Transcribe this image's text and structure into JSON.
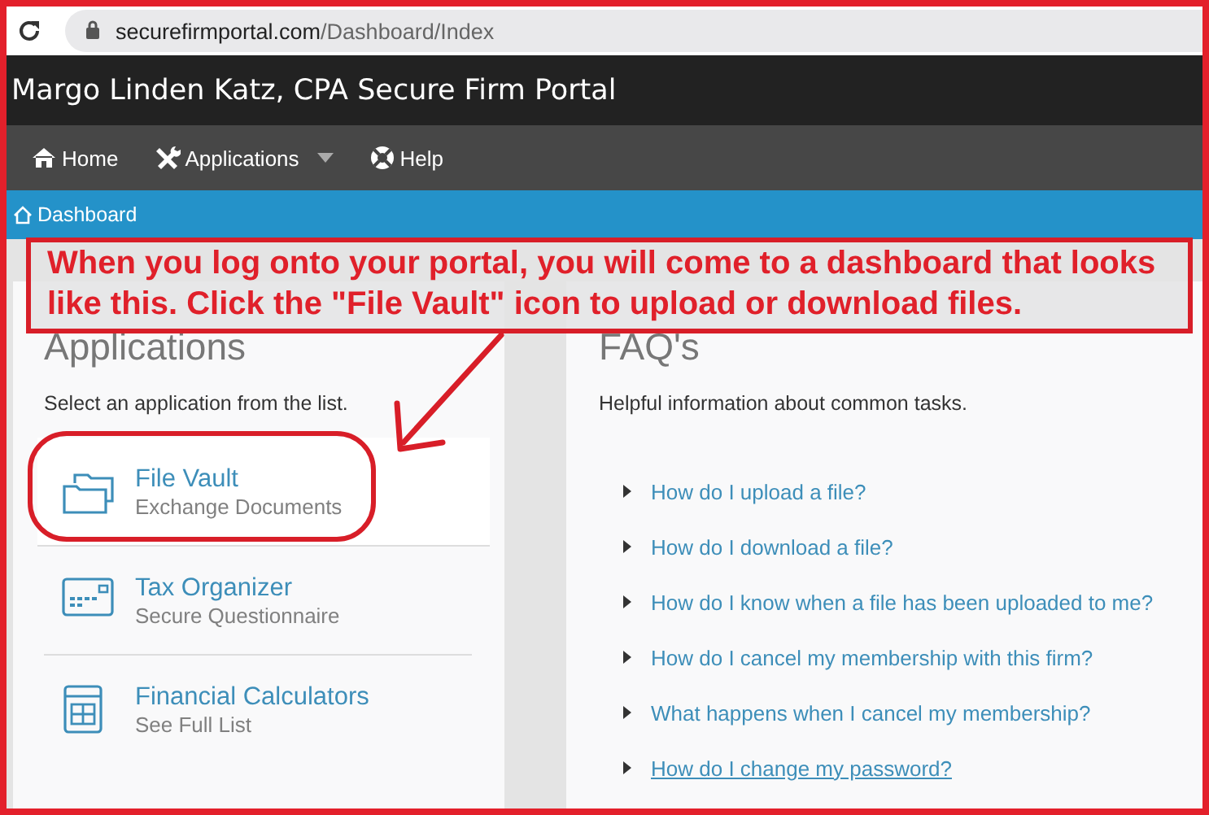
{
  "browser": {
    "url_host": "securefirmportal.com",
    "url_path": "/Dashboard/Index"
  },
  "header": {
    "title": "Margo Linden Katz, CPA Secure Firm Portal"
  },
  "nav": [
    {
      "label": "Home",
      "kind": "home",
      "dropdown": false
    },
    {
      "label": "Applications",
      "kind": "tools",
      "dropdown": true
    },
    {
      "label": "Help",
      "kind": "help",
      "dropdown": false
    }
  ],
  "breadcrumb": {
    "label": "Dashboard"
  },
  "annotation": {
    "text": "When you log onto your portal, you will come to a dashboard that looks like this. Click the \"File Vault\" icon to upload or download files."
  },
  "applications": {
    "title": "Applications",
    "subtitle": "Select an application from the list.",
    "items": [
      {
        "kind": "folder",
        "name": "File Vault",
        "description": "Exchange Documents",
        "hovered": true,
        "circled": true
      },
      {
        "kind": "card",
        "name": "Tax Organizer",
        "description": "Secure Questionnaire",
        "hovered": false,
        "circled": false
      },
      {
        "kind": "calculator",
        "name": "Financial Calculators",
        "description": "See Full List",
        "hovered": false,
        "circled": false
      }
    ]
  },
  "faqs": {
    "title": "FAQ's",
    "subtitle": "Helpful information about common tasks.",
    "items": [
      {
        "question": "How do I upload a file?",
        "hovered": false
      },
      {
        "question": "How do I download a file?",
        "hovered": false
      },
      {
        "question": "How do I know when a file has been uploaded to me?",
        "hovered": false
      },
      {
        "question": "How do I cancel my membership with this firm?",
        "hovered": false
      },
      {
        "question": "What happens when I cancel my membership?",
        "hovered": false
      },
      {
        "question": "How do I change my password?",
        "hovered": true
      }
    ]
  }
}
